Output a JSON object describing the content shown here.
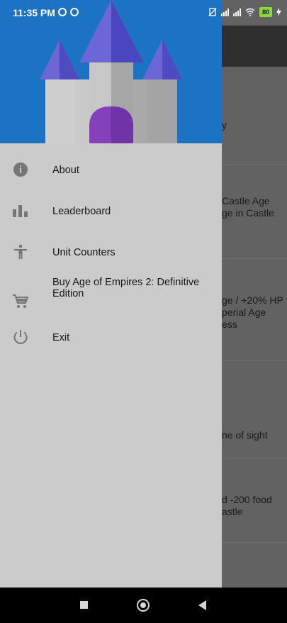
{
  "status_bar": {
    "time": "11:35 PM",
    "battery": "80"
  },
  "background_content": {
    "fragments": [
      "y",
      "Castle Age",
      "ge in Castle",
      "ge / +20% HP",
      "perial Age",
      "ess",
      "ne of sight",
      "d -200 food",
      "astle"
    ]
  },
  "drawer": {
    "menu": [
      {
        "label": "About",
        "icon": "info-icon"
      },
      {
        "label": "Leaderboard",
        "icon": "bar-chart-icon"
      },
      {
        "label": "Unit Counters",
        "icon": "person-icon"
      },
      {
        "label": "Buy Age of Empires 2: Definitive Edition",
        "icon": "cart-icon"
      },
      {
        "label": "Exit",
        "icon": "power-icon"
      }
    ]
  },
  "colors": {
    "header_blue": "#1c73c3",
    "drawer_bg": "#cbcbcb",
    "castle_roof": "#5b5bd0",
    "castle_door": "#7d3fb6"
  }
}
